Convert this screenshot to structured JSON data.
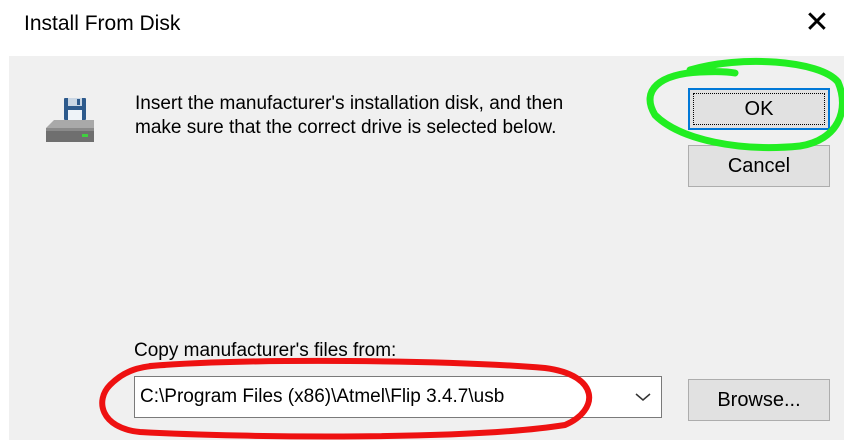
{
  "window": {
    "title": "Install From Disk",
    "close_glyph": "✕"
  },
  "message": {
    "line1": "Insert the manufacturer's installation disk, and then",
    "line2": "make sure that the correct drive is selected below."
  },
  "buttons": {
    "ok": "OK",
    "cancel": "Cancel",
    "browse": "Browse..."
  },
  "copy_from": {
    "label": "Copy manufacturer's files from:",
    "value": "C:\\Program Files (x86)\\Atmel\\Flip 3.4.7\\usb"
  },
  "icons": {
    "disk": "floppy-drive-icon",
    "dropdown": "chevron-down-icon",
    "close": "close-icon"
  },
  "annotations": {
    "ok_highlight_color": "#22ee22",
    "path_highlight_color": "#ee1111"
  }
}
